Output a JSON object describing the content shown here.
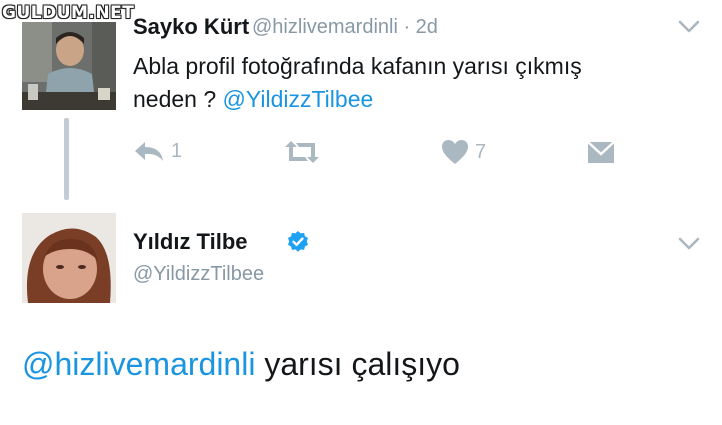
{
  "watermark": "GULDUM.NET",
  "tweet1": {
    "name": "Sayko Kürt",
    "handle": "@hizlivemardinli · 2d",
    "text_line1": "Abla profil fotoğrafında kafanın yarısı çıkmış",
    "text_line2_prefix": "neden ? ",
    "mention": "@YildizzTilbee",
    "reply_count": "1",
    "like_count": "7",
    "icons": [
      "reply-icon",
      "retweet-icon",
      "heart-icon",
      "dm-icon",
      "chevron-down-icon"
    ]
  },
  "tweet2": {
    "name": "Yıldız Tilbe",
    "handle": "@YildizzTilbee",
    "verified": true,
    "reply_mention": "@hizlivemardinli",
    "reply_text": " yarısı çalışıyo"
  },
  "colors": {
    "link": "#1b95e0",
    "muted": "#8899a6",
    "icon": "#aab8c2",
    "verified": "#1da1f2"
  }
}
